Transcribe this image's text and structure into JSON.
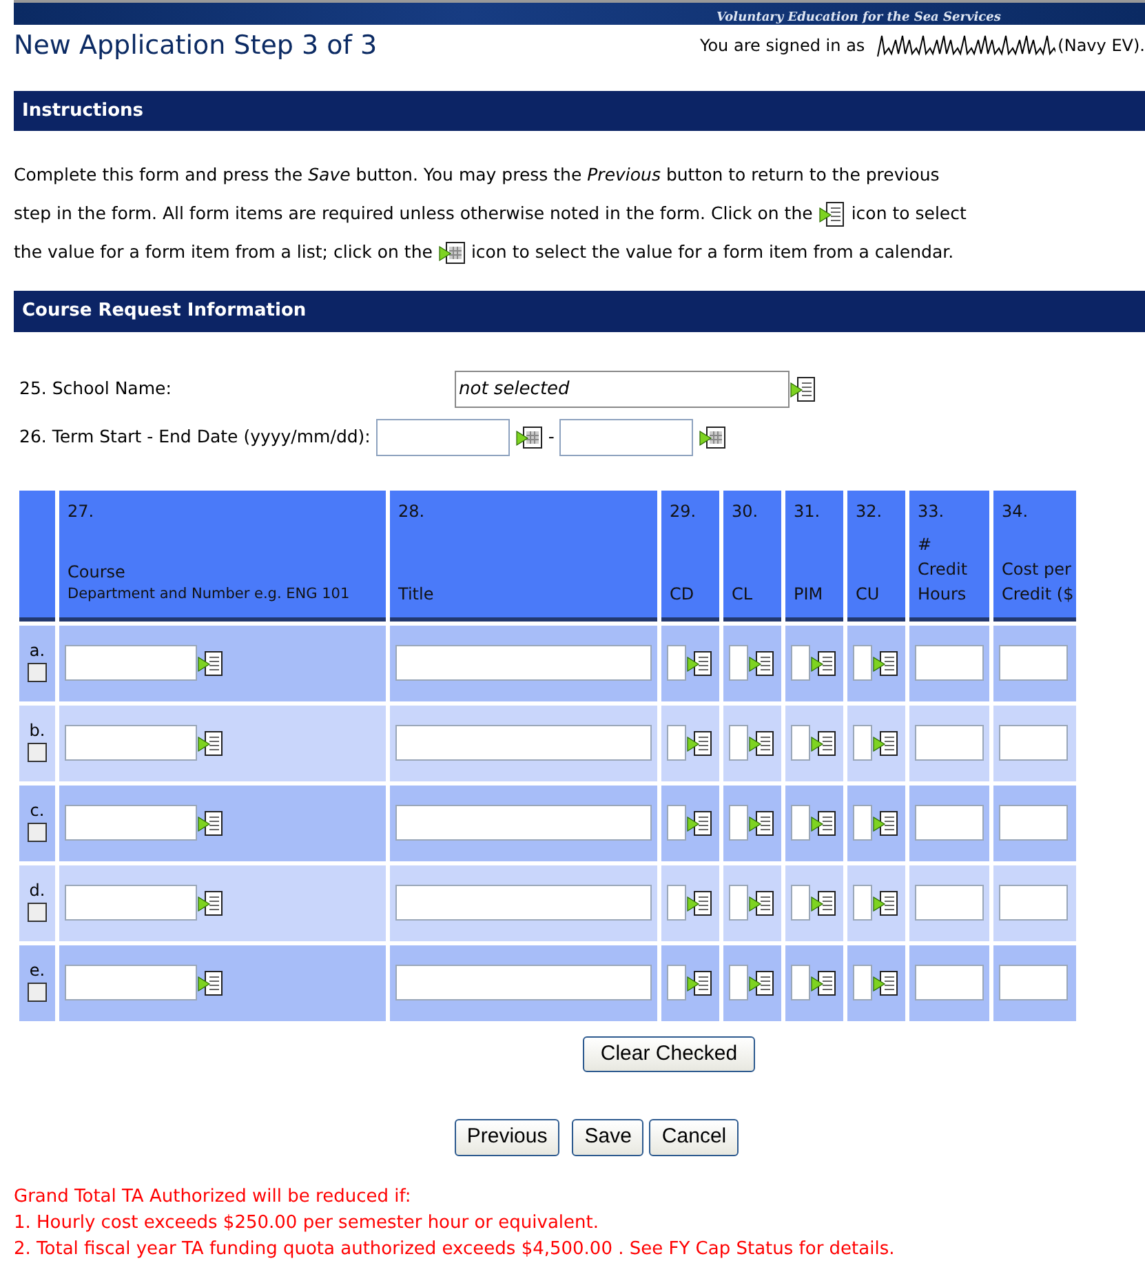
{
  "banner": {
    "text": "Voluntary Education for the Sea Services"
  },
  "page_title": "New Application Step 3 of 3",
  "signed_in": {
    "label": "You are signed in as",
    "suffix": "(Navy EV)."
  },
  "instructions": {
    "heading": "Instructions",
    "lines": [
      [
        {
          "kind": "text",
          "text": "Complete this form and press the *Save* button. You may press the *Previous* button to return to the previous"
        }
      ],
      [
        {
          "kind": "text",
          "text": "step in the form. All form items are required unless otherwise noted in the form. Click on the"
        },
        {
          "kind": "list-icon"
        },
        {
          "kind": "text",
          "text": "icon to select"
        }
      ],
      [
        {
          "kind": "text",
          "text": "the value for a form item from a list; click on the"
        },
        {
          "kind": "calendar-icon"
        },
        {
          "kind": "text",
          "text": "icon to select the value for a form item from a calendar."
        }
      ]
    ]
  },
  "course_request": {
    "heading": "Course Request Information",
    "school": {
      "label": "25. School Name:",
      "value": "not selected"
    },
    "term": {
      "label": "26. Term Start - End Date (yyyy/mm/dd):",
      "separator": "-"
    },
    "table": {
      "columns": [
        {
          "number": "27.",
          "lines": [
            "Course"
          ],
          "hint": "Department and Number e.g. ENG 101",
          "kind": "lookup"
        },
        {
          "number": "28.",
          "lines": [
            "Title"
          ],
          "kind": "text"
        },
        {
          "number": "29.",
          "lines": [
            "CD"
          ],
          "kind": "code"
        },
        {
          "number": "30.",
          "lines": [
            "CL"
          ],
          "kind": "code"
        },
        {
          "number": "31.",
          "lines": [
            "PIM"
          ],
          "kind": "code"
        },
        {
          "number": "32.",
          "lines": [
            "CU"
          ],
          "kind": "code"
        },
        {
          "number": "33.",
          "lines": [
            "#",
            "Credit",
            "Hours"
          ],
          "kind": "short"
        },
        {
          "number": "34.",
          "lines": [
            "Cost per",
            "Credit ($"
          ],
          "kind": "short"
        }
      ],
      "rows": [
        {
          "label": "a.",
          "checked": false
        },
        {
          "label": "b.",
          "checked": false
        },
        {
          "label": "c.",
          "checked": false
        },
        {
          "label": "d.",
          "checked": false
        },
        {
          "label": "e.",
          "checked": false
        }
      ]
    },
    "clear_button": "Clear Checked"
  },
  "nav_buttons": [
    "Previous",
    "Save",
    "Cancel"
  ],
  "notes": [
    "Grand Total TA Authorized will be reduced if:",
    "1. Hourly cost exceeds $250.00 per semester hour or equivalent.",
    "2. Total fiscal year TA funding quota authorized exceeds $4,500.00 . See FY Cap Status for details."
  ]
}
